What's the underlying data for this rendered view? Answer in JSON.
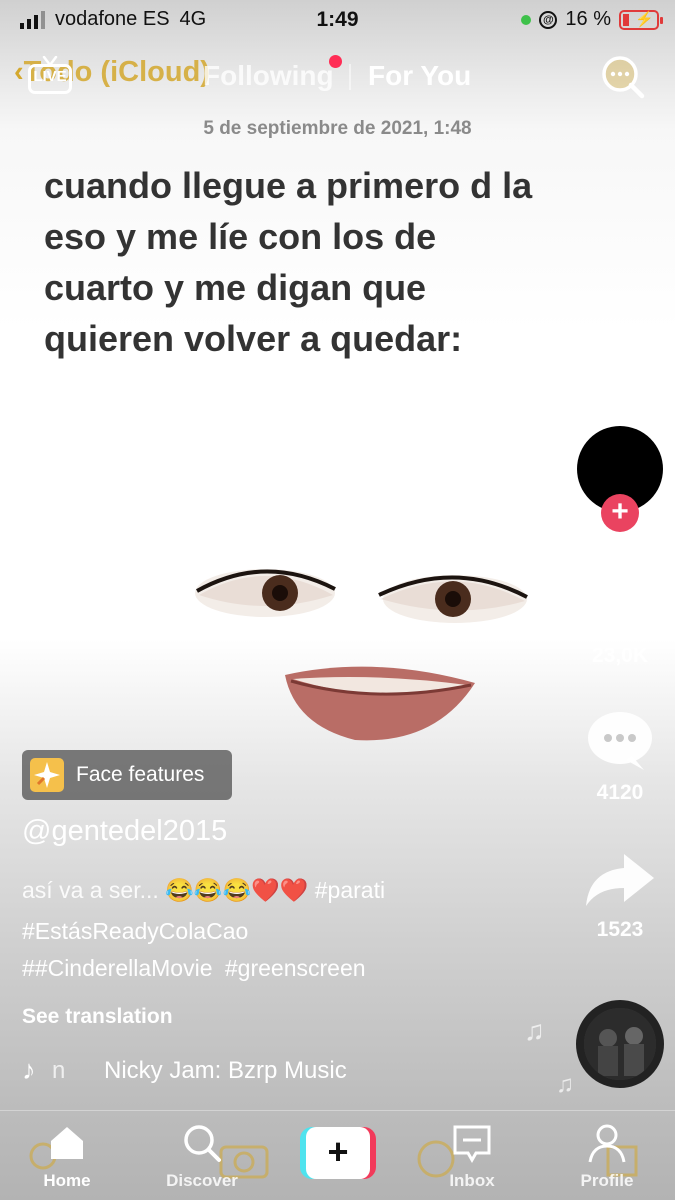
{
  "status_bar": {
    "carrier": "vodafone ES",
    "network": "4G",
    "time": "1:49",
    "battery": "16 %"
  },
  "top_nav": {
    "back_label": "Todo (iCloud)",
    "live_label": "LIVE",
    "tabs": [
      {
        "label": "Following",
        "active": false,
        "has_notification": true
      },
      {
        "label": "For You",
        "active": true
      }
    ]
  },
  "video": {
    "date": "5 de septiembre de 2021, 1:48",
    "caption_lines": [
      "cuando llegue a primero d la",
      "eso y me líe con los de",
      "cuarto y me digan que",
      "quieren volver a quedar:"
    ]
  },
  "right_rail": {
    "likes": "23,0K",
    "comments": "4120",
    "shares": "1523"
  },
  "effect": {
    "label": "Face features"
  },
  "post": {
    "username": "@gentedel2015",
    "description_text": "así va a ser... 😂😂😂❤️❤️",
    "description_tag": "#parati",
    "hashtags_line2": "#EstásReadyColaCao",
    "hashtags_line3_a": "##CinderellaMovie",
    "hashtags_line3_b": "#greenscreen",
    "see_translation": "See translation",
    "music_prefix": "n",
    "music_name": "Nicky Jam: Bzrp Music"
  },
  "bottom_nav": {
    "items": [
      {
        "label": "Home",
        "icon": "home-icon",
        "active": true
      },
      {
        "label": "Discover",
        "icon": "search-icon"
      },
      {
        "label": "",
        "icon": "plus-icon"
      },
      {
        "label": "Inbox",
        "icon": "inbox-icon"
      },
      {
        "label": "Profile",
        "icon": "profile-icon"
      }
    ]
  },
  "colors": {
    "accent_red": "#ea4360",
    "tiktok_cyan": "#4fe3ee",
    "tiktok_pink": "#f23a5a",
    "ios_link_gold": "#d4a82d"
  }
}
